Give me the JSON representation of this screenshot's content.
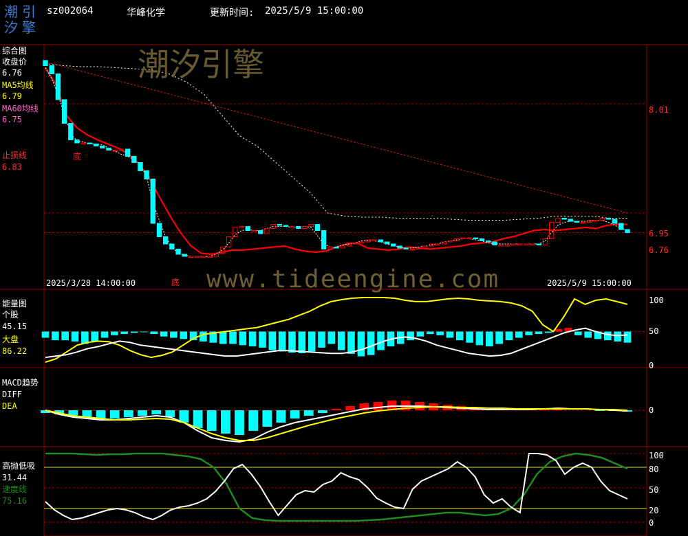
{
  "header": {
    "logo_line1": "潮引",
    "logo_line2": "汐擎",
    "code": "sz002064",
    "name": "华峰化学",
    "update_label": "更新时间:",
    "update_time": "2025/5/9 15:00:00"
  },
  "watermark": {
    "brand": "潮汐引擎",
    "url": "www.tideengine.com"
  },
  "colors": {
    "bg": "#000000",
    "frame": "#a00000",
    "up": "#ff0000",
    "down": "#00ffff",
    "ma5": "#ffffff",
    "ma60": "#ff0000",
    "energy_market": "#ffff00",
    "speed": "#1e8c1e",
    "accent": "#ffff00"
  },
  "panels": {
    "main": {
      "title": "综合图",
      "close_label": "收盘价",
      "close_value": "6.76",
      "ma5_label": "MA5均线",
      "ma5_value": "6.79",
      "ma60_label": "MA60均线",
      "ma60_value": "6.75",
      "stop_label": "止损线",
      "stop_value": "6.83",
      "bottom_marker": "底",
      "start_date": "2025/3/28 14:00:00",
      "end_date": "2025/5/9 15:00:00",
      "right_ticks": [
        "8.01",
        "6.95",
        "6.76"
      ]
    },
    "energy": {
      "title": "能量图",
      "stock_label": "个股",
      "stock_value": "45.15",
      "market_label": "大盘",
      "market_value": "86.22",
      "right_ticks": [
        "100",
        "50",
        "0"
      ]
    },
    "macd": {
      "title": "MACD趋势",
      "diff_label": "DIFF",
      "dea_label": "DEA",
      "right_ticks": [
        "0"
      ]
    },
    "gaopao": {
      "title": "高抛低吸",
      "value": "31.44",
      "speed_label": "速度线",
      "speed_value": "75.16",
      "right_ticks": [
        "100",
        "80",
        "50",
        "20",
        "0"
      ]
    }
  },
  "chart_data": [
    {
      "type": "candlestick",
      "title": "综合图",
      "x_range": [
        "2025/3/28 14:00:00",
        "2025/5/9 15:00:00"
      ],
      "ylim": [
        6.35,
        8.55
      ],
      "reference_lines": [
        8.01,
        6.95,
        6.76
      ],
      "close": [
        8.38,
        8.3,
        8.05,
        7.82,
        7.66,
        7.63,
        7.63,
        7.62,
        7.6,
        7.58,
        7.56,
        7.56,
        7.57,
        7.5,
        7.44,
        7.36,
        7.28,
        6.85,
        6.72,
        6.65,
        6.6,
        6.55,
        6.53,
        6.53,
        6.53,
        6.53,
        6.53,
        6.56,
        6.62,
        6.72,
        6.81,
        6.82,
        6.78,
        6.78,
        6.75,
        6.8,
        6.84,
        6.83,
        6.82,
        6.82,
        6.8,
        6.82,
        6.84,
        6.78,
        6.6,
        6.62,
        6.61,
        6.63,
        6.66,
        6.66,
        6.67,
        6.69,
        6.69,
        6.67,
        6.65,
        6.63,
        6.61,
        6.6,
        6.6,
        6.61,
        6.63,
        6.65,
        6.65,
        6.67,
        6.68,
        6.7,
        6.71,
        6.71,
        6.7,
        6.68,
        6.67,
        6.64,
        6.64,
        6.64,
        6.65,
        6.65,
        6.65,
        6.65,
        6.64,
        6.7,
        6.86,
        6.9,
        6.89,
        6.87,
        6.86,
        6.86,
        6.88,
        6.88,
        6.9,
        6.89,
        6.85,
        6.79,
        6.76
      ],
      "ma5": [
        8.36,
        8.25,
        8.1,
        7.9,
        7.72,
        7.65,
        7.64,
        7.62,
        7.62,
        7.61,
        7.58,
        7.55,
        7.52,
        7.5,
        7.47,
        7.42,
        7.3,
        7.05,
        6.88,
        6.72,
        6.62,
        6.56,
        6.54,
        6.53,
        6.53,
        6.53,
        6.53,
        6.55,
        6.59,
        6.66,
        6.74,
        6.78,
        6.79,
        6.78,
        6.78,
        6.8,
        6.82,
        6.82,
        6.82,
        6.81,
        6.81,
        6.82,
        6.81,
        6.73,
        6.65,
        6.62,
        6.62,
        6.64,
        6.65,
        6.66,
        6.68,
        6.68,
        6.68,
        6.67,
        6.65,
        6.63,
        6.62,
        6.61,
        6.61,
        6.62,
        6.63,
        6.64,
        6.65,
        6.67,
        6.68,
        6.69,
        6.7,
        6.7,
        6.69,
        6.68,
        6.66,
        6.65,
        6.65,
        6.65,
        6.65,
        6.65,
        6.65,
        6.65,
        6.65,
        6.68,
        6.76,
        6.83,
        6.86,
        6.87,
        6.87,
        6.87,
        6.87,
        6.88,
        6.88,
        6.86,
        6.83,
        6.8,
        6.78
      ],
      "ma60": [
        8.36,
        8.2,
        7.9,
        7.78,
        7.71,
        7.66,
        7.62,
        7.58,
        7.52,
        7.43,
        7.28,
        7.1,
        6.92,
        6.76,
        6.63,
        6.56,
        6.55,
        6.57,
        6.59,
        6.59,
        6.6,
        6.61,
        6.62,
        6.63,
        6.6,
        6.58,
        6.57,
        6.58,
        6.62,
        6.65,
        6.66,
        6.61,
        6.6,
        6.59,
        6.6,
        6.62,
        6.61,
        6.6,
        6.61,
        6.62,
        6.63,
        6.65,
        6.66,
        6.67,
        6.7,
        6.72,
        6.75,
        6.78,
        6.79,
        6.78,
        6.79,
        6.8,
        6.81,
        6.8,
        6.83,
        6.84,
        6.84
      ],
      "stop": [
        8.4,
        8.38,
        8.37,
        8.37,
        8.36,
        8.35,
        8.34,
        8.3,
        8.22,
        8.1,
        7.9,
        7.7,
        7.6,
        7.45,
        7.3,
        7.15,
        6.95,
        6.92,
        6.91,
        6.91,
        6.9,
        6.9,
        6.9,
        6.89,
        6.88,
        6.88,
        6.88,
        6.89,
        6.9,
        6.92,
        6.92,
        6.92,
        6.9,
        6.9
      ],
      "bottom_markers": [
        7.45,
        6.42
      ]
    },
    {
      "type": "bar+line",
      "title": "能量图",
      "ylim": [
        0,
        100
      ],
      "series": [
        {
          "name": "个股",
          "values": [
            12,
            14,
            16,
            20,
            25,
            28,
            32,
            36,
            34,
            30,
            28,
            26,
            24,
            22,
            20,
            18,
            16,
            14,
            14,
            16,
            18,
            20,
            22,
            22,
            21,
            20,
            19,
            18,
            18,
            20,
            24,
            30,
            36,
            40,
            42,
            40,
            36,
            30,
            26,
            22,
            18,
            16,
            14,
            15,
            18,
            24,
            30,
            36,
            42,
            48,
            52,
            55,
            50,
            46,
            44,
            45
          ]
        },
        {
          "name": "大盘",
          "values": [
            5,
            10,
            20,
            30,
            34,
            36,
            35,
            30,
            22,
            16,
            12,
            15,
            20,
            30,
            40,
            46,
            48,
            50,
            52,
            54,
            56,
            60,
            64,
            68,
            74,
            80,
            88,
            94,
            97,
            99,
            100,
            100,
            100,
            99,
            96,
            94,
            94,
            96,
            98,
            99,
            98,
            96,
            95,
            94,
            92,
            88,
            80,
            60,
            50,
            72,
            98,
            90,
            96,
            98,
            94,
            90
          ]
        }
      ],
      "bars": [
        -10,
        -14,
        -14,
        -16,
        -20,
        -16,
        -10,
        -6,
        -4,
        -2,
        -1,
        -4,
        -8,
        -10,
        -12,
        -14,
        -16,
        -18,
        -20,
        -20,
        -22,
        -24,
        -26,
        -30,
        -32,
        -34,
        -35,
        -32,
        -26,
        -20,
        -30,
        -36,
        -40,
        -38,
        -30,
        -24,
        -20,
        -14,
        -8,
        -4,
        -6,
        -10,
        -14,
        -18,
        -22,
        -24,
        -20,
        -14,
        -10,
        -6,
        -4,
        -2,
        4,
        6,
        -6,
        -10,
        -12,
        -14,
        -16,
        -18
      ]
    },
    {
      "type": "macd",
      "title": "MACD趋势",
      "series": [
        {
          "name": "DIFF",
          "values": [
            0,
            -6,
            -10,
            -12,
            -14,
            -14,
            -12,
            -10,
            -8,
            -10,
            -18,
            -30,
            -40,
            -44,
            -46,
            -42,
            -32,
            -24,
            -18,
            -14,
            -10,
            -6,
            -2,
            2,
            4,
            6,
            6,
            6,
            5,
            4,
            3,
            2,
            1,
            1,
            1,
            1,
            2,
            3,
            2,
            2,
            1,
            0,
            -1
          ]
        },
        {
          "name": "DEA",
          "values": [
            0,
            -4,
            -8,
            -10,
            -12,
            -14,
            -14,
            -13,
            -12,
            -13,
            -18,
            -26,
            -34,
            -40,
            -44,
            -44,
            -40,
            -34,
            -28,
            -22,
            -17,
            -12,
            -8,
            -4,
            -1,
            1,
            3,
            4,
            5,
            5,
            4,
            4,
            3,
            3,
            2,
            2,
            2,
            2,
            2,
            2,
            1,
            1,
            0
          ]
        }
      ],
      "bars": [
        -4,
        -6,
        -8,
        -10,
        -12,
        -12,
        -10,
        -8,
        -6,
        -10,
        -18,
        -26,
        -30,
        -34,
        -36,
        -30,
        -24,
        -18,
        -12,
        -8,
        -4,
        2,
        6,
        10,
        12,
        14,
        14,
        12,
        10,
        8,
        6,
        4,
        2,
        1,
        1,
        1,
        1,
        1,
        0,
        0,
        -1,
        -1,
        -2
      ]
    },
    {
      "type": "line",
      "title": "高抛低吸",
      "ylim": [
        0,
        100
      ],
      "reference_lines": [
        100,
        80,
        50,
        20,
        0
      ],
      "series": [
        {
          "name": "高抛低吸",
          "values": [
            30,
            18,
            10,
            4,
            6,
            10,
            14,
            18,
            20,
            18,
            14,
            8,
            4,
            10,
            18,
            22,
            24,
            28,
            34,
            45,
            60,
            78,
            84,
            70,
            52,
            30,
            10,
            25,
            40,
            46,
            44,
            55,
            60,
            72,
            66,
            62,
            50,
            35,
            28,
            22,
            20,
            48,
            60,
            66,
            72,
            78,
            88,
            80,
            66,
            40,
            28,
            34,
            22,
            14,
            100,
            100,
            98,
            90,
            70,
            80,
            86,
            80,
            60,
            46,
            40,
            34
          ]
        },
        {
          "name": "速度线",
          "values": [
            100,
            100,
            100,
            99,
            98,
            99,
            99,
            100,
            100,
            100,
            98,
            96,
            92,
            80,
            56,
            20,
            6,
            3,
            2,
            2,
            2,
            2,
            2,
            2,
            2,
            3,
            4,
            6,
            8,
            10,
            12,
            14,
            14,
            12,
            10,
            12,
            20,
            40,
            70,
            88,
            96,
            100,
            98,
            94,
            86,
            78
          ]
        }
      ]
    }
  ]
}
